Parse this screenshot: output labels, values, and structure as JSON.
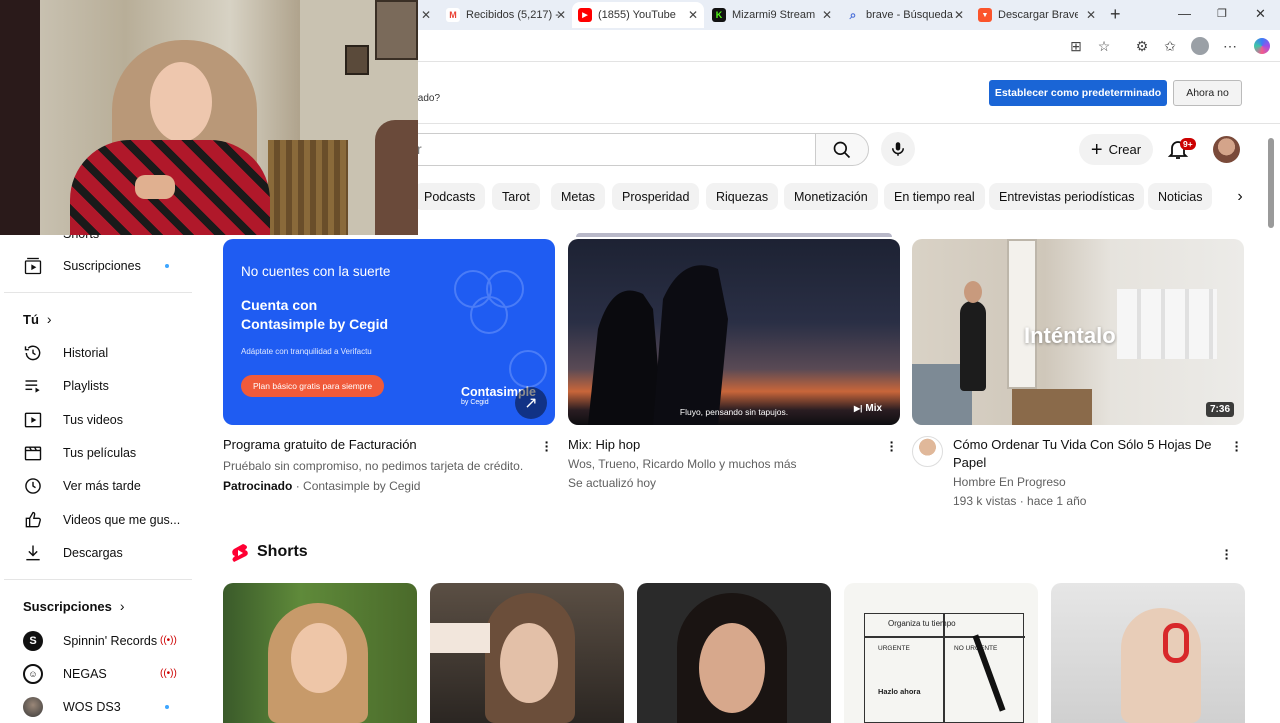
{
  "browser": {
    "tabs": [
      {
        "title": "Recibidos (5,217) -",
        "color": "#ea4335",
        "glyph": "M",
        "active": false
      },
      {
        "title": "(1855) YouTube",
        "color": "#ff0000",
        "glyph": "▶",
        "active": true
      },
      {
        "title": "Mizarmi9 Stream",
        "color": "#53fc18",
        "glyph": "K",
        "active": false
      },
      {
        "title": "brave - Búsqueda",
        "color": "#4b6fd9",
        "glyph": "⌕",
        "active": false
      },
      {
        "title": "Descargar Brave B",
        "color": "#fb542b",
        "glyph": "▼",
        "active": false
      }
    ],
    "new_tab_label": "+",
    "close_glyph": "✕"
  },
  "banner": {
    "text": "inado?",
    "set_default_label": "Establecer como predeterminado",
    "not_now_label": "Ahora no"
  },
  "header": {
    "search_placeholder": "r",
    "create_label": "Crear",
    "notif_badge": "9+"
  },
  "chips": [
    "Podcasts",
    "Tarot",
    "Metas",
    "Prosperidad",
    "Riquezas",
    "Monetización",
    "En tiempo real",
    "Entrevistas periodísticas",
    "Noticias"
  ],
  "sidebar": {
    "shorts_label": "Shorts",
    "subscriptions_label": "Suscripciones",
    "you_header": "Tú",
    "you_items": [
      {
        "label": "Historial",
        "icon": "history-icon"
      },
      {
        "label": "Playlists",
        "icon": "playlists-icon"
      },
      {
        "label": "Tus videos",
        "icon": "your-videos-icon"
      },
      {
        "label": "Tus películas",
        "icon": "movies-icon"
      },
      {
        "label": "Ver más tarde",
        "icon": "watch-later-icon"
      },
      {
        "label": "Videos que me gus...",
        "icon": "thumb-up-icon"
      },
      {
        "label": "Descargas",
        "icon": "download-icon"
      }
    ],
    "subs_header": "Suscripciones",
    "channels": [
      {
        "label": "Spinnin' Records",
        "status": "live"
      },
      {
        "label": "NEGAS",
        "status": "live"
      },
      {
        "label": "WOS DS3",
        "status": "new"
      }
    ]
  },
  "videos": [
    {
      "title": "Programa gratuito de Facturación",
      "line1": "Pruébalo sin compromiso, no pedimos tarjeta de crédito.",
      "sponsored": "Patrocinado",
      "advertiser": "· Contasimple by Cegid",
      "ad": {
        "headline": "No cuentes con la suerte",
        "title1": "Cuenta con",
        "title2": "Contasimple by Cegid",
        "sub": "Adáptate con tranquilidad a Verifactu",
        "cta": "Plan básico gratis para siempre",
        "brand": "Contasimple",
        "brand_sub": "by Cegid"
      }
    },
    {
      "title": "Mix: Hip hop",
      "line1": "Wos, Trueno, Ricardo Mollo y muchos más",
      "line2": "Se actualizó hoy",
      "caption": "Fluyo, pensando sin tapujos.",
      "badge": "Mix"
    },
    {
      "title": "Cómo Ordenar Tu Vida Con Sólo 5 Hojas De Papel",
      "channel": "Hombre En Progreso",
      "stats": "193 k vistas · hace 1 año",
      "overlay": "Inténtalo",
      "duration": "7:36"
    }
  ],
  "shorts_section": {
    "title": "Shorts",
    "short4_text": "Organiza tu tiempo",
    "short4_words": [
      "URGENTE",
      "NO URGENTE",
      "Hazlo ahora"
    ]
  }
}
